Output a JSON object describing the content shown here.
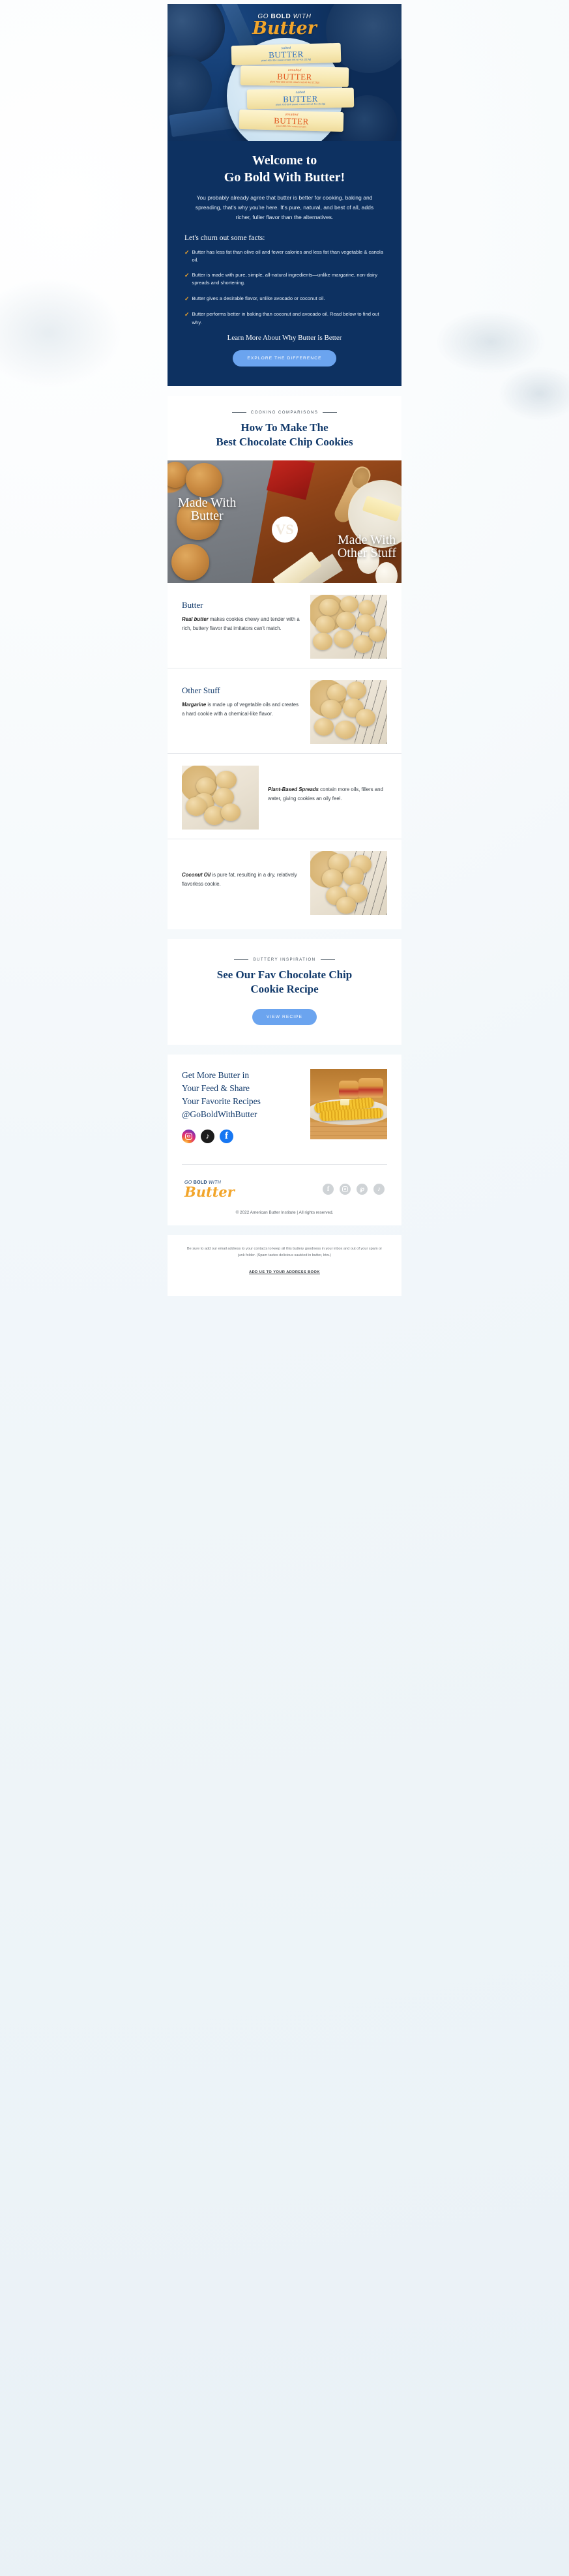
{
  "brand": {
    "logo_line1_pre": "GO ",
    "logo_line1_bold": "BOLD",
    "logo_line1_post": " WITH",
    "logo_script": "Butter",
    "accent_gold": "#f2a52b",
    "brand_navy": "#0d3161",
    "button_blue": "#6ba4ef"
  },
  "hero": {
    "title_line1": "Welcome to",
    "title_line2": "Go Bold With Butter!",
    "subtitle": "You probably already agree that butter is better for cooking, baking and spreading, that's why you're here. It's pure, natural, and best of all, adds richer, fuller flavor than the alternatives.",
    "facts_heading": "Let's churn out some facts:",
    "facts": [
      "Butter has less fat than olive oil and fewer calories and less fat than vegetable & canola oil.",
      "Butter is made with pure, simple, all-natural ingredients—unlike margarine, non-dairy spreads and shortening.",
      "Butter gives a desirable flavor, unlike avocado or coconut oil.",
      "Butter performs better in baking than coconut and avocado oil. Read below to find out why."
    ],
    "cta_label": "Learn More About Why Butter is Better",
    "cta_button": "EXPLORE THE DIFFERENCE",
    "product_sticks": [
      {
        "kind": "salted",
        "word": "BUTTER",
        "fine": "plant #55-304    sweet cream    net wt 4oz (113g)"
      },
      {
        "kind": "unsalted",
        "word": "BUTTER",
        "fine": "plant #55-304    sweet cream    net wt 4oz (113g)"
      },
      {
        "kind": "salted",
        "word": "BUTTER",
        "fine": "plant #55-304    sweet cream    net wt 4oz (113g)"
      },
      {
        "kind": "unsalted",
        "word": "BUTTER",
        "fine": "plant #55-304    sweet cream"
      }
    ]
  },
  "comparisons_section": {
    "eyebrow": "COOKING COMPARISONS",
    "title_line1": "How To Make The",
    "title_line2": "Best Chocolate Chip Cookies",
    "vs_left_line1": "Made With",
    "vs_left_line2": "Butter",
    "vs_badge": "VS",
    "vs_right_line1": "Made With",
    "vs_right_line2": "Other Stuff",
    "rows": [
      {
        "title": "Butter",
        "lead": "Real butter",
        "body": " makes cookies chewy and tender with a rich, buttery flavor that imitators can't match.",
        "image_side": "right"
      },
      {
        "title": "Other Stuff",
        "lead": "Margarine",
        "body": " is made up of vegetable oils and creates a hard cookie with a chemical-like flavor.",
        "image_side": "right"
      },
      {
        "title": "",
        "lead": "Plant-Based Spreads",
        "body": " contain more oils, fillers and water, giving cookies an oily feel.",
        "image_side": "left"
      },
      {
        "title": "",
        "lead": "Coconut Oil",
        "body": " is pure fat, resulting in a dry, relatively flavorless cookie.",
        "image_side": "right"
      }
    ]
  },
  "recipe_section": {
    "eyebrow": "BUTTERY INSPIRATION",
    "title_line1": "See Our Fav Chocolate Chip",
    "title_line2": "Cookie Recipe",
    "button": "VIEW RECIPE"
  },
  "follow_section": {
    "title_line1": "Get More Butter in",
    "title_line2": "Your Feed & Share",
    "title_line3": "Your Favorite Recipes",
    "title_line4": "@GoBoldWithButter",
    "socials": [
      {
        "name": "instagram",
        "glyph": ""
      },
      {
        "name": "tiktok",
        "glyph": "♪"
      },
      {
        "name": "facebook",
        "glyph": "f"
      }
    ]
  },
  "footer": {
    "socials": [
      {
        "name": "facebook",
        "glyph": "f"
      },
      {
        "name": "instagram",
        "glyph": ""
      },
      {
        "name": "pinterest",
        "glyph": "℘"
      },
      {
        "name": "tiktok",
        "glyph": "♪"
      }
    ],
    "copyright": "© 2022 American Butter Institute | All rights reserved.",
    "legal_line1": "Be sure to add our email address to your contacts to keep all this buttery goodness in your inbox and",
    "legal_line2": "out of your spam or junk folder. (Spam tastes delicious sautéed in butter, btw.)",
    "legal_link": "ADD US TO YOUR ADDRESS BOOK"
  }
}
